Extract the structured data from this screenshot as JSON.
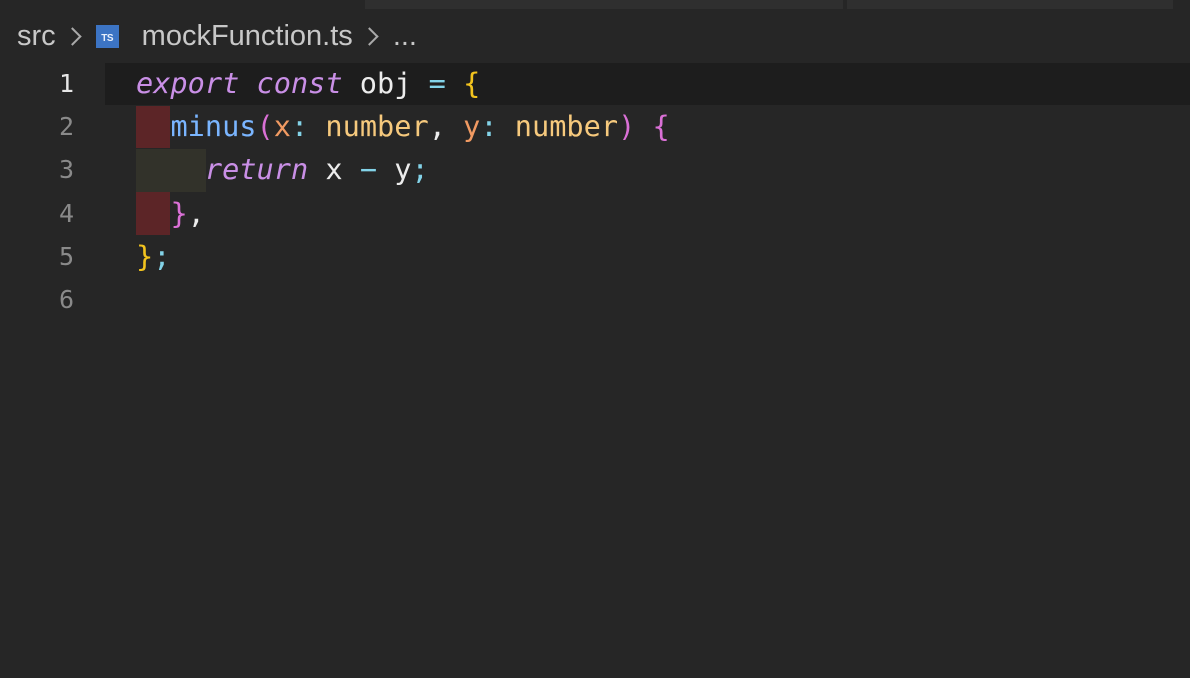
{
  "breadcrumb": {
    "folder": "src",
    "file_icon_text": "TS",
    "file": "mockFunction.ts",
    "more": "..."
  },
  "gutter": {
    "line_numbers": [
      "1",
      "2",
      "3",
      "4",
      "5",
      "6"
    ],
    "active_line": "1"
  },
  "code": {
    "language": "TypeScript",
    "lines": [
      {
        "tokens": [
          {
            "t": "export",
            "c": "kw"
          },
          {
            "t": " ",
            "c": "plain"
          },
          {
            "t": "const",
            "c": "kw"
          },
          {
            "t": " obj ",
            "c": "plain"
          },
          {
            "t": "=",
            "c": "op"
          },
          {
            "t": " ",
            "c": "plain"
          },
          {
            "t": "{",
            "c": "brace-y"
          }
        ]
      },
      {
        "tokens": [
          {
            "t": "  ",
            "c": "plain"
          },
          {
            "t": "minus",
            "c": "fn"
          },
          {
            "t": "(",
            "c": "brace-p"
          },
          {
            "t": "x",
            "c": "param"
          },
          {
            "t": ": ",
            "c": "op"
          },
          {
            "t": "number",
            "c": "type"
          },
          {
            "t": ", ",
            "c": "plain"
          },
          {
            "t": "y",
            "c": "param"
          },
          {
            "t": ": ",
            "c": "op"
          },
          {
            "t": "number",
            "c": "type"
          },
          {
            "t": ")",
            "c": "brace-p"
          },
          {
            "t": " ",
            "c": "plain"
          },
          {
            "t": "{",
            "c": "brace-p"
          }
        ]
      },
      {
        "tokens": [
          {
            "t": "    ",
            "c": "plain"
          },
          {
            "t": "return",
            "c": "kw"
          },
          {
            "t": " x ",
            "c": "plain"
          },
          {
            "t": "−",
            "c": "op"
          },
          {
            "t": " y",
            "c": "plain"
          },
          {
            "t": ";",
            "c": "op"
          }
        ]
      },
      {
        "tokens": [
          {
            "t": "  ",
            "c": "plain"
          },
          {
            "t": "}",
            "c": "brace-p"
          },
          {
            "t": ",",
            "c": "plain"
          }
        ]
      },
      {
        "tokens": [
          {
            "t": "}",
            "c": "brace-y"
          },
          {
            "t": ";",
            "c": "op"
          }
        ]
      },
      {
        "tokens": []
      }
    ]
  },
  "colors": {
    "background": "#262626",
    "keyword": "#c98fe6",
    "function": "#7ab5ff",
    "parameter": "#f19a62",
    "type": "#f6c97d",
    "brace_outer": "#f2c31e",
    "brace_inner": "#da70d6",
    "operator": "#83d3e8"
  }
}
